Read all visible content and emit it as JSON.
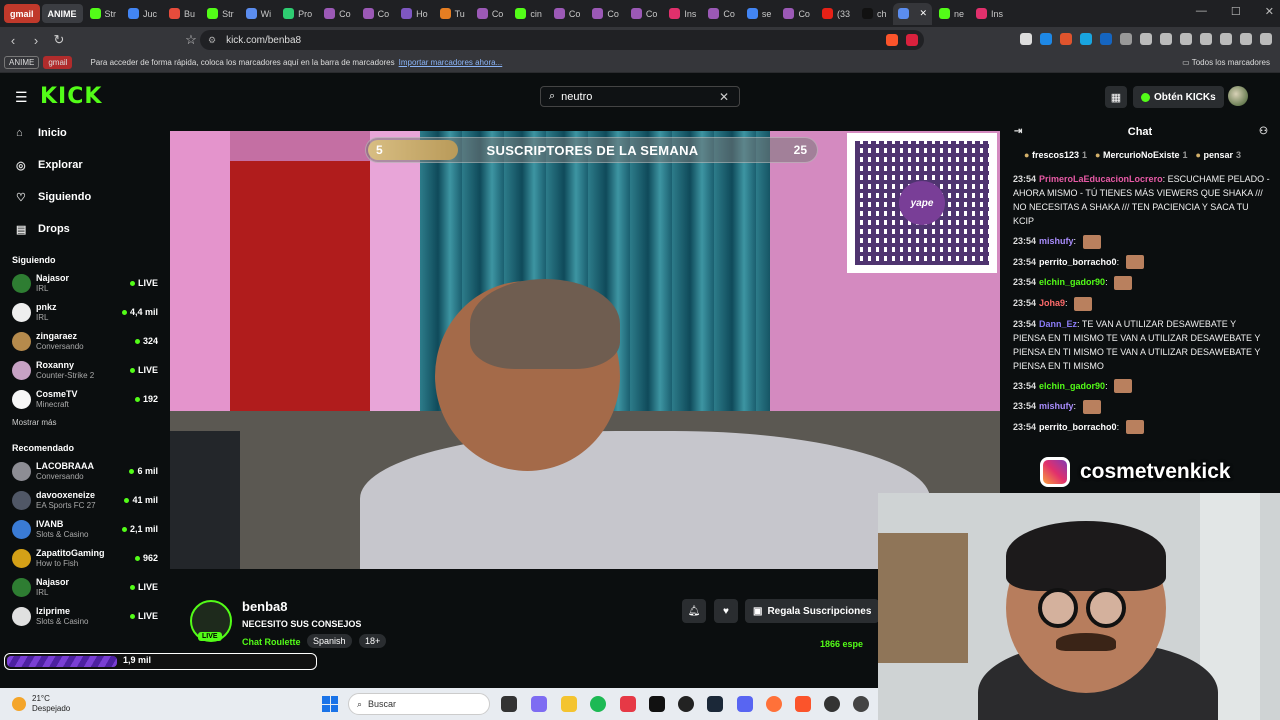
{
  "browser": {
    "tabs": [
      {
        "label": "gmail",
        "kind": "first"
      },
      {
        "label": "ANIME",
        "kind": "anime"
      },
      {
        "label": "Str",
        "color": "#53fc18"
      },
      {
        "label": "Juc",
        "color": "#4285f4"
      },
      {
        "label": "Bu",
        "color": "#e74c3c"
      },
      {
        "label": "Str",
        "color": "#53fc18"
      },
      {
        "label": "Wi",
        "color": "#5b8def"
      },
      {
        "label": "Pro",
        "color": "#2ecc71"
      },
      {
        "label": "Co",
        "color": "#9b59b6"
      },
      {
        "label": "Co",
        "color": "#9b59b6"
      },
      {
        "label": "Ho",
        "color": "#7e57c2"
      },
      {
        "label": "Tu",
        "color": "#e67e22"
      },
      {
        "label": "Co",
        "color": "#9b59b6"
      },
      {
        "label": "cin",
        "color": "#53fc18"
      },
      {
        "label": "Co",
        "color": "#9b59b6"
      },
      {
        "label": "Co",
        "color": "#9b59b6"
      },
      {
        "label": "Co",
        "color": "#9b59b6"
      },
      {
        "label": "Ins",
        "color": "#e1306c"
      },
      {
        "label": "Co",
        "color": "#9b59b6"
      },
      {
        "label": "se",
        "color": "#4285f4"
      },
      {
        "label": "Co",
        "color": "#9b59b6"
      },
      {
        "label": "(33",
        "color": "#e62117"
      },
      {
        "label": "ch",
        "color": "#111111"
      },
      {
        "label": "",
        "color": "#5b8def",
        "kind": "active"
      },
      {
        "label": "ne",
        "color": "#53fc18"
      },
      {
        "label": "Ins",
        "color": "#e1306c"
      }
    ],
    "url": "kick.com/benba8",
    "bookmarks": {
      "anime": "ANIME",
      "gmail": "gmail",
      "hint": "Para acceder de forma rápida, coloca los marcadores aquí en la barra de marcadores",
      "import": "Importar marcadores ahora...",
      "all": "Todos los marcadores"
    }
  },
  "kick": {
    "logo": "KICK",
    "search_value": "neutro",
    "get_kicks": "Obtén KICKs",
    "nav": [
      {
        "label": "Inicio",
        "icon": "home-icon",
        "glyph": "⌂"
      },
      {
        "label": "Explorar",
        "icon": "compass-icon",
        "glyph": "◎"
      },
      {
        "label": "Siguiendo",
        "icon": "heart-icon",
        "glyph": "♡"
      },
      {
        "label": "Drops",
        "icon": "drops-icon",
        "glyph": "▤"
      }
    ],
    "following_title": "Siguiendo",
    "following": [
      {
        "name": "Najasor",
        "sub": "IRL",
        "count": "LIVE",
        "color": "#2e7d32"
      },
      {
        "name": "pnkz",
        "sub": "IRL",
        "count": "4,4 mil",
        "color": "#eeeeee"
      },
      {
        "name": "zingaraez",
        "sub": "Conversando",
        "count": "324",
        "color": "#b58a4c"
      },
      {
        "name": "Roxanny",
        "sub": "Counter-Strike 2",
        "count": "LIVE",
        "color": "#c7a2c4"
      },
      {
        "name": "CosmeTV",
        "sub": "Minecraft",
        "count": "192",
        "color": "#f7f7f7"
      }
    ],
    "show_more": "Mostrar más",
    "recommended_title": "Recomendado",
    "recommended": [
      {
        "name": "LACOBRAAA",
        "sub": "Conversando",
        "count": "6 mil",
        "color": "#8d8d94"
      },
      {
        "name": "davooxeneize",
        "sub": "EA Sports FC 27",
        "count": "41 mil",
        "color": "#505766"
      },
      {
        "name": "IVANB",
        "sub": "Slots & Casino",
        "count": "2,1 mil",
        "color": "#3a7bd5"
      },
      {
        "name": "ZapatitoGaming",
        "sub": "How to Fish",
        "count": "962",
        "color": "#d4a017"
      },
      {
        "name": "Najasor",
        "sub": "IRL",
        "count": "LIVE",
        "color": "#2e7d32"
      },
      {
        "name": "lziprime",
        "sub": "Slots & Casino",
        "count": "LIVE",
        "color": "#e0e0e0"
      }
    ],
    "mini_value": "1,9 mil"
  },
  "video": {
    "sub_goal": {
      "current": "5",
      "label": "SUSCRIPTORES DE LA SEMANA",
      "target": "25",
      "progress": 0.2
    },
    "qr_label": "yape"
  },
  "channel": {
    "name": "benba8",
    "title": "NECESITO SUS CONSEJOS",
    "category": "Chat Roulette",
    "tags": [
      "Spanish",
      "18+"
    ],
    "live": "LIVE",
    "gift": "Regala Suscripciones",
    "viewers": "1866 espe"
  },
  "chat": {
    "title": "Chat",
    "pinned": [
      {
        "name": "frescos123",
        "n": "1"
      },
      {
        "name": "MercurioNoExiste",
        "n": "1"
      },
      {
        "name": "pensar",
        "n": "3"
      }
    ],
    "messages": [
      {
        "time": "23:54",
        "user": "PrimeroLaEducacionLocrero",
        "color": "#e85aa6",
        "text": "ESCUCHAME PELADO - AHORA MISMO - TÚ TIENES MÁS VIEWERS QUE SHAKA /// NO NECESITAS A SHAKA /// TEN PACIENCIA Y SACA TU KCIP",
        "emote": false
      },
      {
        "time": "23:54",
        "user": "mishufy",
        "color": "#a78bfa",
        "text": "",
        "emote": true
      },
      {
        "time": "23:54",
        "user": "perrito_borracho0",
        "color": "#ffffff",
        "text": "",
        "emote": true
      },
      {
        "time": "23:54",
        "user": "elchin_gador90",
        "color": "#53fc18",
        "text": "",
        "emote": true
      },
      {
        "time": "23:54",
        "user": "Joha9",
        "color": "#ff6b6b",
        "text": "",
        "emote": true
      },
      {
        "time": "23:54",
        "user": "Dann_Ez",
        "color": "#8b7cf6",
        "text": "TE VAN A UTILIZAR DESAWEBATE Y PIENSA EN TI MISMO TE VAN A UTILIZAR DESAWEBATE Y PIENSA EN TI MISMO TE VAN A UTILIZAR DESAWEBATE Y PIENSA EN TI MISMO",
        "emote": false
      },
      {
        "time": "23:54",
        "user": "elchin_gador90",
        "color": "#53fc18",
        "text": "",
        "emote": true
      },
      {
        "time": "23:54",
        "user": "mishufy",
        "color": "#a78bfa",
        "text": "",
        "emote": true
      },
      {
        "time": "23:54",
        "user": "perrito_borracho0",
        "color": "#ffffff",
        "text": "",
        "emote": true
      }
    ]
  },
  "overlay": {
    "instagram": "cosmetvenkick"
  },
  "taskbar": {
    "temp": "21°C",
    "weather": "Despejado",
    "search": "Buscar"
  }
}
